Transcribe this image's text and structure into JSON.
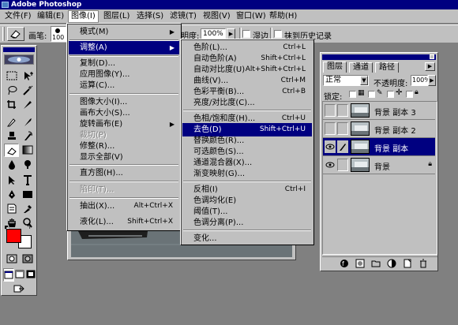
{
  "window": {
    "title": "Adobe Photoshop"
  },
  "menubar": {
    "items": [
      {
        "label": "文件(F)"
      },
      {
        "label": "编辑(E)"
      },
      {
        "label": "图像(I)"
      },
      {
        "label": "图层(L)"
      },
      {
        "label": "选择(S)"
      },
      {
        "label": "滤镜(T)"
      },
      {
        "label": "视图(V)"
      },
      {
        "label": "窗口(W)"
      },
      {
        "label": "帮助(H)"
      }
    ]
  },
  "options": {
    "brush_label": "画笔:",
    "brush_size": "100",
    "opacity_label": "明度:",
    "opacity_value": "100%",
    "wet_edges_label": "湿边",
    "erase_history_label": "抹到历史记录"
  },
  "image_menu": {
    "items": [
      {
        "label": "模式(M)",
        "submenu": true
      },
      {
        "label": "调整(A)",
        "submenu": true,
        "highlighted": true
      },
      {
        "label": "复制(D)..."
      },
      {
        "label": "应用图像(Y)..."
      },
      {
        "label": "运算(C)..."
      },
      {
        "label": "图像大小(I)..."
      },
      {
        "label": "画布大小(S)..."
      },
      {
        "label": "旋转画布(E)",
        "submenu": true
      },
      {
        "label": "裁切(P)",
        "disabled": true
      },
      {
        "label": "修整(R)..."
      },
      {
        "label": "显示全部(V)"
      },
      {
        "label": "直方图(H)..."
      },
      {
        "label": "陷印(T)...",
        "disabled": true
      },
      {
        "label": "抽出(X)...",
        "shortcut": "Alt+Ctrl+X"
      },
      {
        "label": "液化(L)...",
        "shortcut": "Shift+Ctrl+X"
      }
    ]
  },
  "adjust_menu": {
    "items": [
      {
        "label": "色阶(L)...",
        "shortcut": "Ctrl+L"
      },
      {
        "label": "自动色阶(A)",
        "shortcut": "Shift+Ctrl+L"
      },
      {
        "label": "自动对比度(U)",
        "shortcut": "Alt+Shift+Ctrl+L"
      },
      {
        "label": "曲线(V)...",
        "shortcut": "Ctrl+M"
      },
      {
        "label": "色彩平衡(B)...",
        "shortcut": "Ctrl+B"
      },
      {
        "label": "亮度/对比度(C)..."
      },
      {
        "label": "色相/饱和度(H)...",
        "shortcut": "Ctrl+U"
      },
      {
        "label": "去色(D)",
        "shortcut": "Shift+Ctrl+U",
        "highlighted": true
      },
      {
        "label": "替换颜色(R)..."
      },
      {
        "label": "可选颜色(S)..."
      },
      {
        "label": "通道混合器(X)..."
      },
      {
        "label": "渐变映射(G)..."
      },
      {
        "label": "反相(I)",
        "shortcut": "Ctrl+I"
      },
      {
        "label": "色调均化(E)"
      },
      {
        "label": "阈值(T)..."
      },
      {
        "label": "色调分离(P)..."
      },
      {
        "label": "变化..."
      }
    ]
  },
  "layers_palette": {
    "tabs": [
      {
        "label": "图层",
        "active": true
      },
      {
        "label": "通道"
      },
      {
        "label": "路径"
      }
    ],
    "blend_mode": "正常",
    "opacity_label": "不透明度:",
    "opacity_value": "100%",
    "lock_label": "锁定:",
    "layers": [
      {
        "name": "背景 副本 3",
        "visible": false,
        "selected": false,
        "locked": false
      },
      {
        "name": "背景 副本 2",
        "visible": false,
        "selected": false,
        "locked": false
      },
      {
        "name": "背景 副本",
        "visible": true,
        "selected": true,
        "locked": false
      },
      {
        "name": "背景",
        "visible": true,
        "selected": false,
        "locked": true
      }
    ]
  },
  "colors": {
    "foreground": "#ff0000",
    "background": "#ffffff",
    "title_bar": "#000080",
    "highlight": "#000080",
    "face": "#c0c0c0",
    "desktop": "#808080"
  }
}
